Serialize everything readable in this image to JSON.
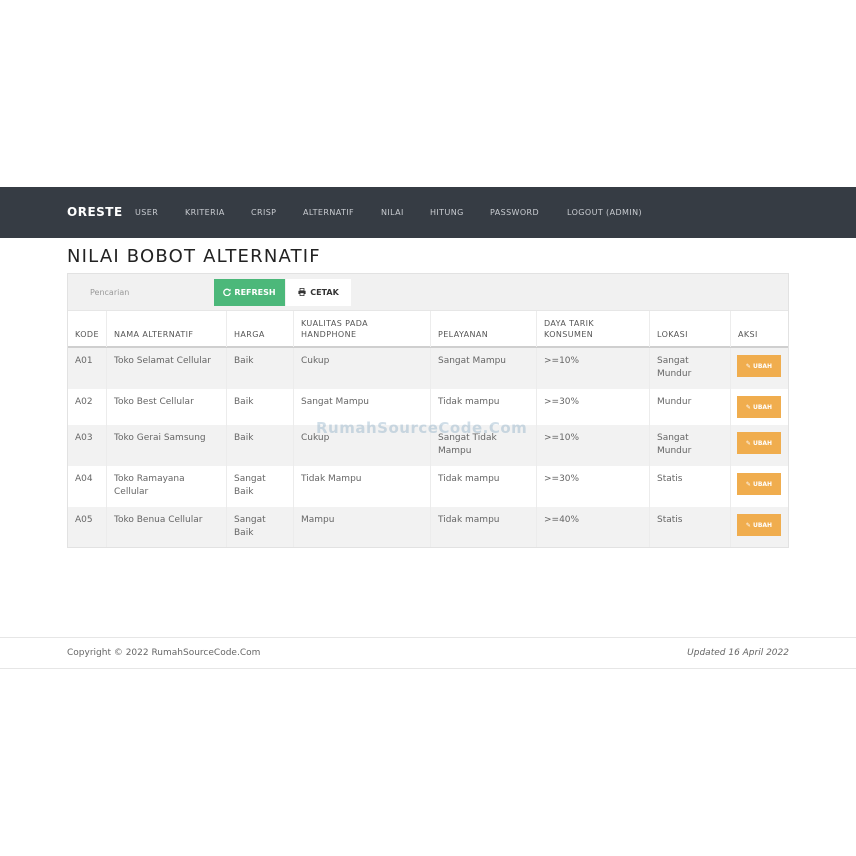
{
  "navbar": {
    "brand": "ORESTE",
    "items": [
      {
        "label": "USER"
      },
      {
        "label": "KRITERIA"
      },
      {
        "label": "CRISP"
      },
      {
        "label": "ALTERNATIF"
      },
      {
        "label": "NILAI"
      },
      {
        "label": "HITUNG"
      },
      {
        "label": "PASSWORD"
      },
      {
        "label": "LOGOUT (ADMIN)"
      }
    ]
  },
  "page": {
    "title": "NILAI BOBOT ALTERNATIF"
  },
  "toolbar": {
    "search_placeholder": "Pencarian",
    "refresh_label": "REFRESH",
    "print_label": "CETAK"
  },
  "table": {
    "headers": {
      "kode": "KODE",
      "nama": "NAMA ALTERNATIF",
      "harga": "HARGA",
      "kualitas_1": "KUALITAS PADA",
      "kualitas_2": "HANDPHONE",
      "pelayanan": "PELAYANAN",
      "daya_1": "DAYA TARIK",
      "daya_2": "KONSUMEN",
      "lokasi": "LOKASI",
      "aksi": "AKSI"
    },
    "rows": [
      {
        "kode": "A01",
        "nama": "Toko Selamat Cellular",
        "harga": "Baik",
        "kualitas": "Cukup",
        "pelayanan": "Sangat Mampu",
        "daya": ">=10%",
        "lokasi": "Sangat Mundur",
        "aksi": "UBAH"
      },
      {
        "kode": "A02",
        "nama": "Toko Best Cellular",
        "harga": "Baik",
        "kualitas": "Sangat Mampu",
        "pelayanan": "Tidak mampu",
        "daya": ">=30%",
        "lokasi": "Mundur",
        "aksi": "UBAH"
      },
      {
        "kode": "A03",
        "nama": "Toko Gerai Samsung",
        "harga": "Baik",
        "kualitas": "Cukup",
        "pelayanan": "Sangat Tidak Mampu",
        "daya": ">=10%",
        "lokasi": "Sangat Mundur",
        "aksi": "UBAH"
      },
      {
        "kode": "A04",
        "nama": "Toko Ramayana Cellular",
        "harga": "Sangat Baik",
        "kualitas": "Tidak Mampu",
        "pelayanan": "Tidak mampu",
        "daya": ">=30%",
        "lokasi": "Statis",
        "aksi": "UBAH"
      },
      {
        "kode": "A05",
        "nama": "Toko Benua Cellular",
        "harga": "Sangat Baik",
        "kualitas": "Mampu",
        "pelayanan": "Tidak mampu",
        "daya": ">=40%",
        "lokasi": "Statis",
        "aksi": "UBAH"
      }
    ]
  },
  "watermark": "RumahSourceCode.Com",
  "footer": {
    "copyright": "Copyright © 2022 RumahSourceCode.Com",
    "updated": "Updated 16 April 2022"
  },
  "colors": {
    "navbar_bg": "#363c44",
    "refresh_button": "#4cb87a",
    "edit_button": "#f0ad4e"
  }
}
